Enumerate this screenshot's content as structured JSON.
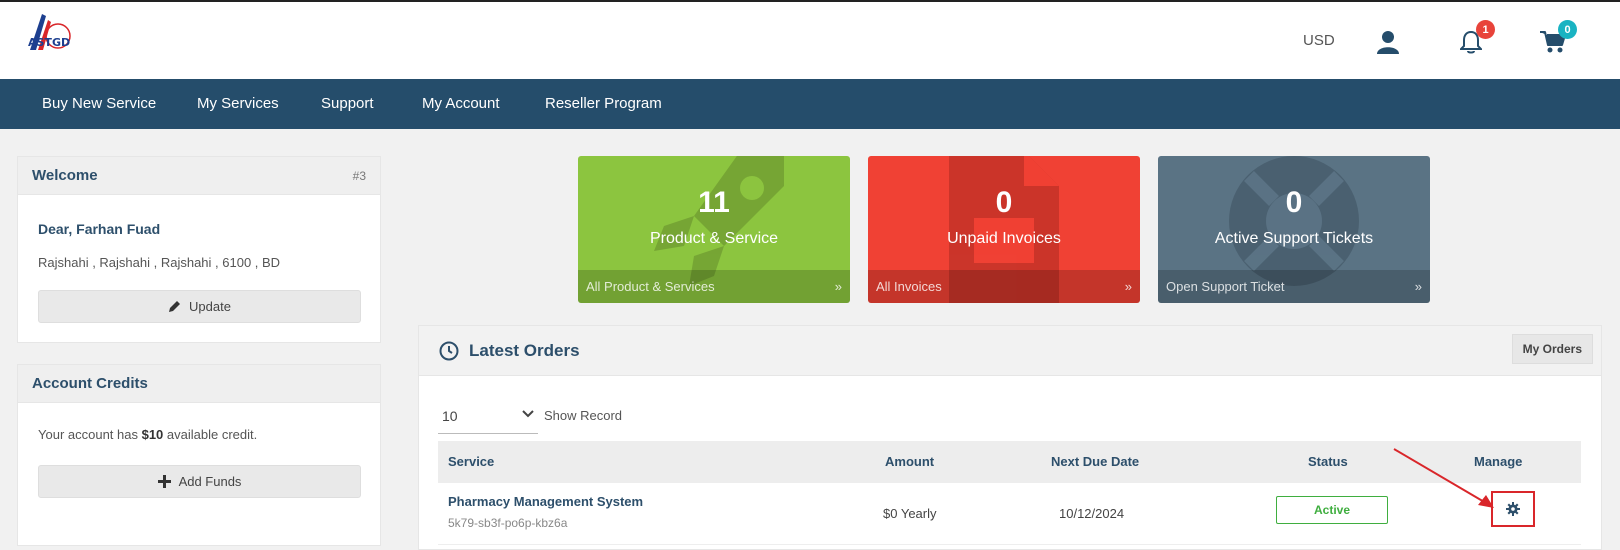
{
  "header": {
    "logo_text": "ASTGD",
    "currency": "USD",
    "notifications_count": "1",
    "cart_count": "0"
  },
  "nav": {
    "items": [
      "Buy New Service",
      "My Services",
      "Support",
      "My Account",
      "Reseller Program"
    ]
  },
  "welcome": {
    "title": "Welcome",
    "id": "#3",
    "greeting": "Dear, Farhan Fuad",
    "address": "Rajshahi , Rajshahi , Rajshahi , 6100 , BD",
    "update_label": "Update"
  },
  "credits": {
    "title": "Account Credits",
    "text_before": "Your account has ",
    "amount": "$10",
    "text_after": " available credit.",
    "add_funds_label": "Add Funds"
  },
  "tiles": [
    {
      "count": "11",
      "label": "Product & Service",
      "link": "All Product & Services",
      "color": "#8cc53f"
    },
    {
      "count": "0",
      "label": "Unpaid Invoices",
      "link": "All Invoices",
      "color": "#f04134"
    },
    {
      "count": "0",
      "label": "Active Support Tickets",
      "link": "Open Support Ticket",
      "color": "#5a7384"
    }
  ],
  "tile_chevron": "»",
  "orders": {
    "title": "Latest Orders",
    "my_orders_label": "My Orders",
    "page_size": "10",
    "show_record": "Show Record",
    "columns": [
      "Service",
      "Amount",
      "Next Due Date",
      "Status",
      "Manage"
    ],
    "rows": [
      {
        "service": "Pharmacy Management System",
        "code": "5k79-sb3f-po6p-kbz6a",
        "amount": "$0 Yearly",
        "due": "10/12/2024",
        "status": "Active"
      }
    ]
  },
  "icons": {
    "user": "user-icon",
    "bell": "bell-icon",
    "cart": "cart-icon",
    "pencil": "pencil-icon",
    "plus": "plus-icon",
    "clock": "clock-icon",
    "gear": "gear-icon",
    "chevron": "chevron-down-icon"
  },
  "colors": {
    "nav": "#254d6b",
    "accent_text": "#2d4f6b",
    "status_active": "#3fae3f",
    "highlight": "#d9262a"
  }
}
